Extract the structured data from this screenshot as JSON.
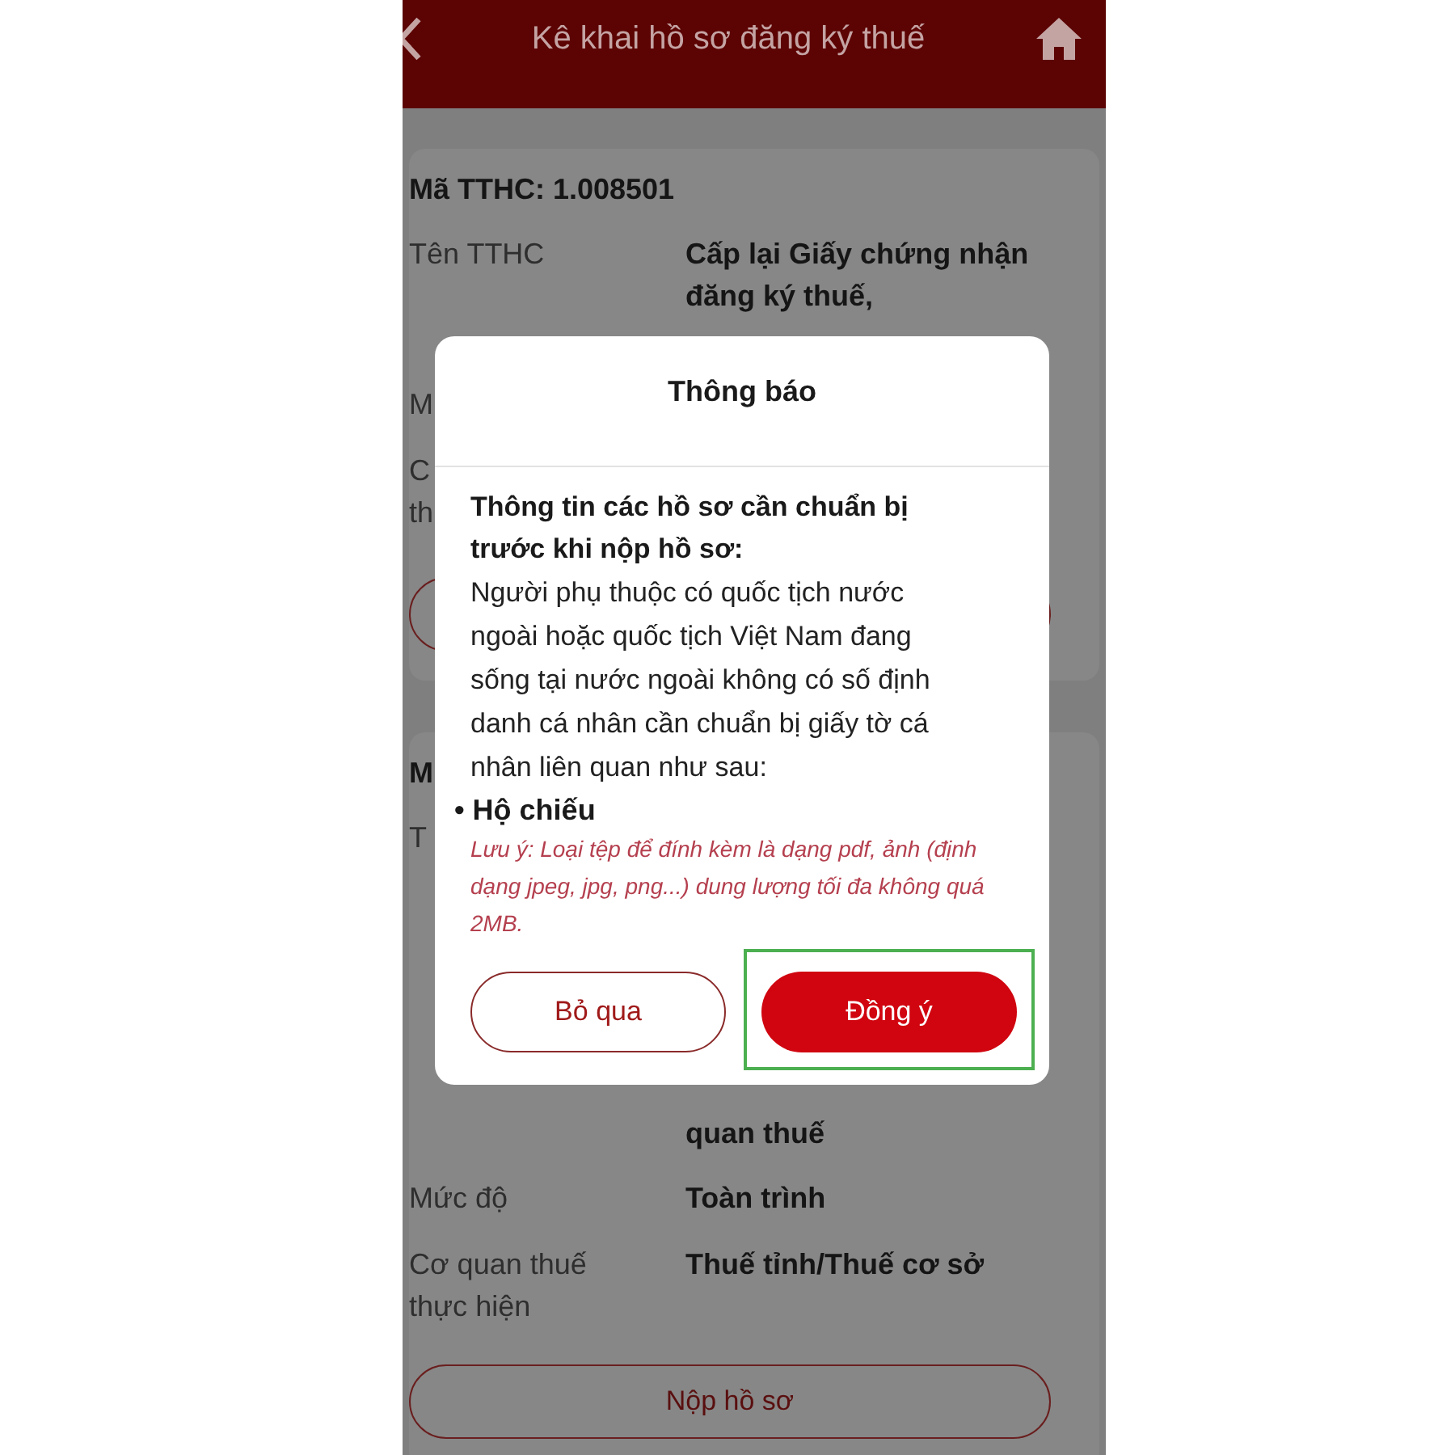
{
  "header": {
    "title": "Kê khai hồ sơ đăng ký thuế"
  },
  "cards": [
    {
      "title": "Mã TTHC: 1.008501",
      "rows": [
        {
          "label_lines": [
            "Tên TTHC"
          ],
          "value": "Cấp lại Giấy chứng nhận đăng ký thuế,"
        },
        {
          "label_lines": [
            "M"
          ]
        },
        {
          "label_lines": [
            "C",
            "th"
          ]
        }
      ],
      "button": {
        "kind": "outline"
      }
    },
    {
      "title": "M",
      "rows": [
        {
          "label_lines": [
            "T"
          ],
          "tail": "quan thuế"
        },
        {
          "label_lines": [
            "Mức độ"
          ],
          "value": "Toàn trình"
        },
        {
          "label_lines": [
            "Cơ quan thuế",
            "thực hiện"
          ],
          "value": "Thuế tỉnh/Thuế cơ sở"
        }
      ],
      "button": {
        "kind": "submit",
        "label": "Nộp hồ sơ"
      }
    }
  ],
  "dialog": {
    "title": "Thông báo",
    "heading": "Thông tin các hồ sơ cần chuẩn bị trước khi nộp hồ sơ:",
    "body": "Người phụ thuộc có quốc tịch nước ngoài hoặc quốc tịch Việt Nam đang sống tại nước ngoài không có số định danh cá nhân cần chuẩn bị giấy tờ cá nhân liên quan như sau:",
    "bullet": "• Hộ chiếu",
    "note": "Lưu ý: Loại tệp để đính kèm là dạng pdf, ảnh (định dạng jpeg, jpg, png...) dung lượng tối đa không quá 2MB.",
    "buttons": [
      {
        "label": "Bỏ qua",
        "kind": "outline",
        "highlighted": false
      },
      {
        "label": "Đồng ý",
        "kind": "primary",
        "highlighted": true
      }
    ]
  }
}
